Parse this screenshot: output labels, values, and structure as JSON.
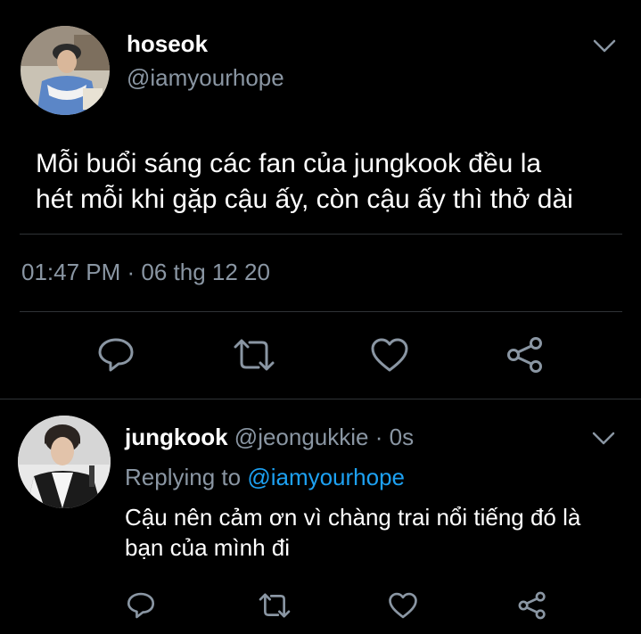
{
  "colors": {
    "background": "#000000",
    "text": "#ffffff",
    "muted": "#8a96a3",
    "accent": "#1da1f2",
    "divider": "#2f3336"
  },
  "main_tweet": {
    "display_name": "hoseok",
    "handle": "@iamyourhope",
    "text_line1": "Mỗi buổi sáng các fan của jungkook đều la",
    "text_line2": "hét mỗi khi gặp cậu ấy, còn cậu ấy thì thở dài",
    "timestamp": "01:47 PM · 06 thg 12 20",
    "actions": [
      "reply-icon",
      "retweet-icon",
      "like-icon",
      "share-icon"
    ]
  },
  "reply_tweet": {
    "display_name": "jungkook",
    "handle_time": "@jeongukkie · 0s",
    "replying_to_label": "Replying to",
    "replying_to_handle": "@iamyourhope",
    "text_line1": "Cậu nên cảm ơn vì chàng trai nổi tiếng đó là",
    "text_line2": "bạn của mình đi",
    "actions": [
      "reply-icon",
      "retweet-icon",
      "like-icon",
      "share-icon"
    ]
  }
}
